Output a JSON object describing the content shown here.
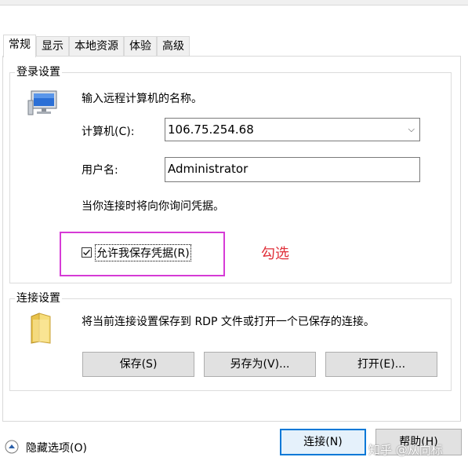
{
  "tabs": [
    "常规",
    "显示",
    "本地资源",
    "体验",
    "高级"
  ],
  "login": {
    "group_title": "登录设置",
    "instruction": "输入远程计算机的名称。",
    "computer_label": "计算机(C):",
    "computer_value": "106.75.254.68",
    "username_label": "用户名:",
    "username_value": "Administrator",
    "prompt_note": "当你连接时将向你询问凭据。",
    "save_credentials_label": "允许我保存凭据(R)",
    "save_credentials_checked": true
  },
  "annotation": {
    "text": "勾选",
    "color": "#e0303a",
    "highlight_color": "#d63bd6"
  },
  "connection": {
    "group_title": "连接设置",
    "description": "将当前连接设置保存到 RDP 文件或打开一个已保存的连接。",
    "save_button": "保存(S)",
    "save_as_button": "另存为(V)...",
    "open_button": "打开(E)..."
  },
  "footer": {
    "hide_options": "隐藏选项(O)",
    "connect_button": "连接(N)",
    "help_button": "帮助(H)",
    "watermark": "知乎 @从向标"
  },
  "icons": {
    "computer": "monitor-icon",
    "folder": "folder-icon",
    "expand": "chevron-up-circle-icon",
    "dropdown": "chevron-down-icon"
  }
}
